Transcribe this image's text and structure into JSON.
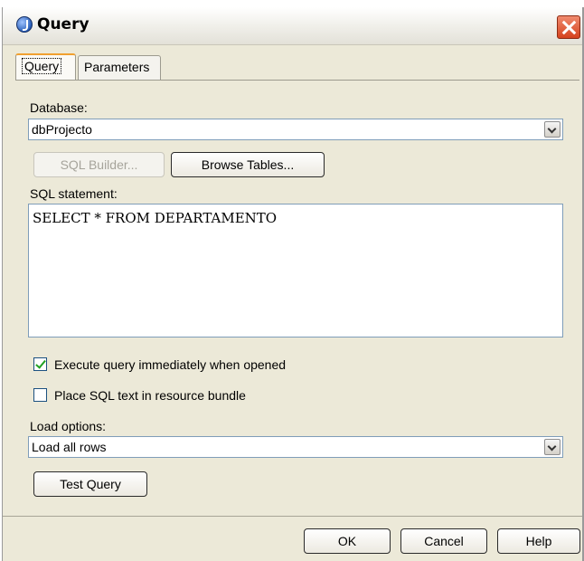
{
  "window": {
    "title": "Query"
  },
  "tabs": [
    {
      "label": "Query",
      "active": true
    },
    {
      "label": "Parameters",
      "active": false
    }
  ],
  "query_tab": {
    "database_label": "Database:",
    "database_value": "dbProjecto",
    "sql_builder_label": "SQL Builder...",
    "browse_tables_label": "Browse Tables...",
    "sql_statement_label": "SQL statement:",
    "sql_text": "SELECT * FROM DEPARTAMENTO",
    "execute_immediately": {
      "label": "Execute query immediately when opened",
      "checked": true
    },
    "place_in_bundle": {
      "label": "Place SQL text in resource bundle",
      "checked": false
    },
    "load_options_label": "Load options:",
    "load_options_value": "Load all rows",
    "test_query_label": "Test Query"
  },
  "footer": {
    "ok_label": "OK",
    "cancel_label": "Cancel",
    "help_label": "Help"
  }
}
